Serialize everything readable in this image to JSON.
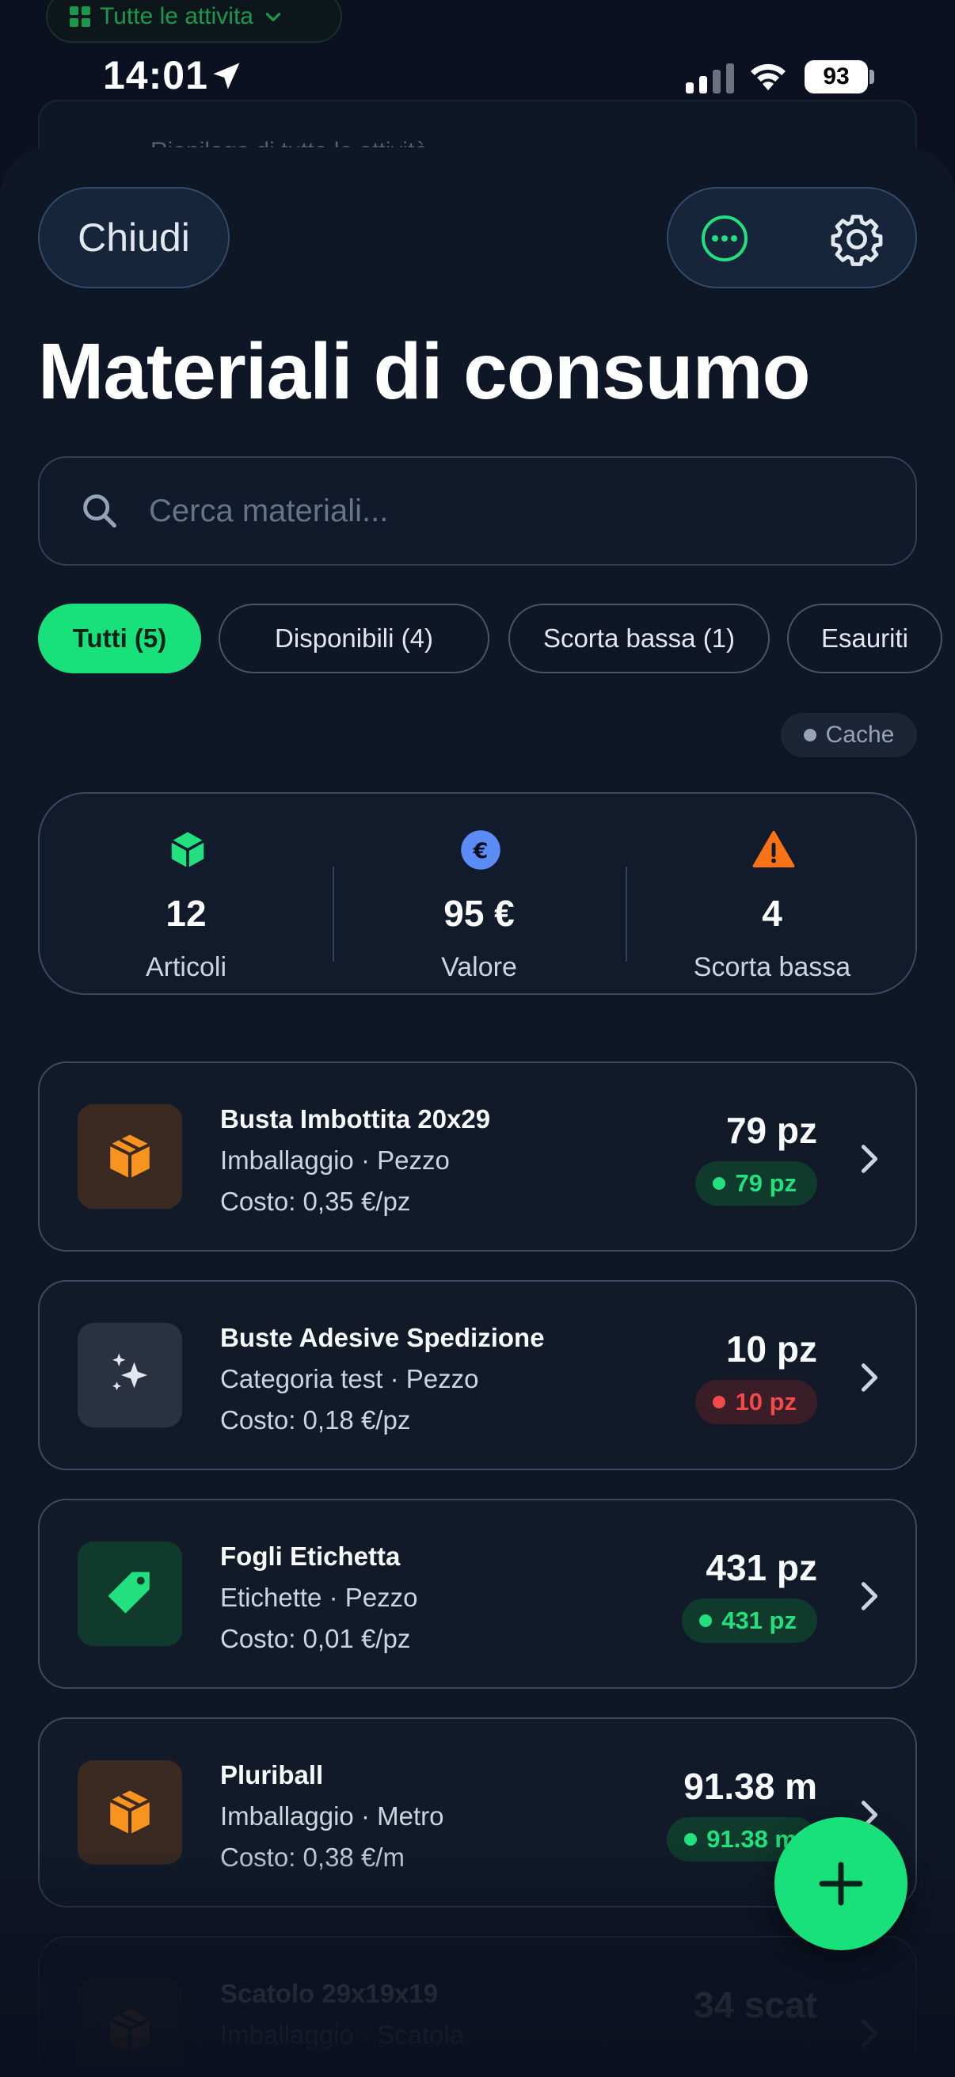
{
  "background": {
    "chip_label": "Tutte le attivita",
    "card_text": "Riepilogo di tutte le attività"
  },
  "status_bar": {
    "time": "14:01",
    "battery": "93"
  },
  "header": {
    "close_label": "Chiudi",
    "title": "Materiali di consumo"
  },
  "search": {
    "placeholder": "Cerca materiali..."
  },
  "filters": [
    {
      "label": "Tutti (5)",
      "active": true
    },
    {
      "label": "Disponibili (4)",
      "active": false
    },
    {
      "label": "Scorta bassa (1)",
      "active": false
    },
    {
      "label": "Esauriti",
      "active": false
    }
  ],
  "cache_label": "Cache",
  "stats": [
    {
      "icon": "box-icon",
      "value": "12",
      "label": "Articoli",
      "color": "#22e07e"
    },
    {
      "icon": "euro-icon",
      "value": "95 €",
      "label": "Valore",
      "color": "#5b8cf5"
    },
    {
      "icon": "warning-icon",
      "value": "4",
      "label": "Scorta bassa",
      "color": "#f97316"
    }
  ],
  "items": [
    {
      "name": "Busta Imbottita 20x29",
      "subtitle": "Imballaggio · Pezzo",
      "cost": "Costo: 0,35 €/pz",
      "quantity": "79 pz",
      "badge": "79 pz",
      "status": "ok",
      "icon": "package-icon"
    },
    {
      "name": "Buste Adesive Spedizione",
      "subtitle": "Categoria test · Pezzo",
      "cost": "Costo: 0,18 €/pz",
      "quantity": "10 pz",
      "badge": "10 pz",
      "status": "low",
      "icon": "sparkles-icon"
    },
    {
      "name": "Fogli Etichetta",
      "subtitle": "Etichette · Pezzo",
      "cost": "Costo: 0,01 €/pz",
      "quantity": "431 pz",
      "badge": "431 pz",
      "status": "ok",
      "icon": "tag-icon"
    },
    {
      "name": "Pluriball",
      "subtitle": "Imballaggio · Metro",
      "cost": "Costo: 0,38 €/m",
      "quantity": "91.38 m",
      "badge": "91.38 m",
      "status": "ok",
      "icon": "package-icon"
    },
    {
      "name": "Scatolo 29x19x19",
      "subtitle": "Imballaggio · Scatola",
      "cost": "",
      "quantity": "34 scat",
      "badge": "",
      "status": "ok",
      "icon": "package-icon"
    }
  ],
  "colors": {
    "accent": "#18e07a",
    "danger": "#f04a4a",
    "background": "#0b1120",
    "sheet": "#0f1626"
  }
}
